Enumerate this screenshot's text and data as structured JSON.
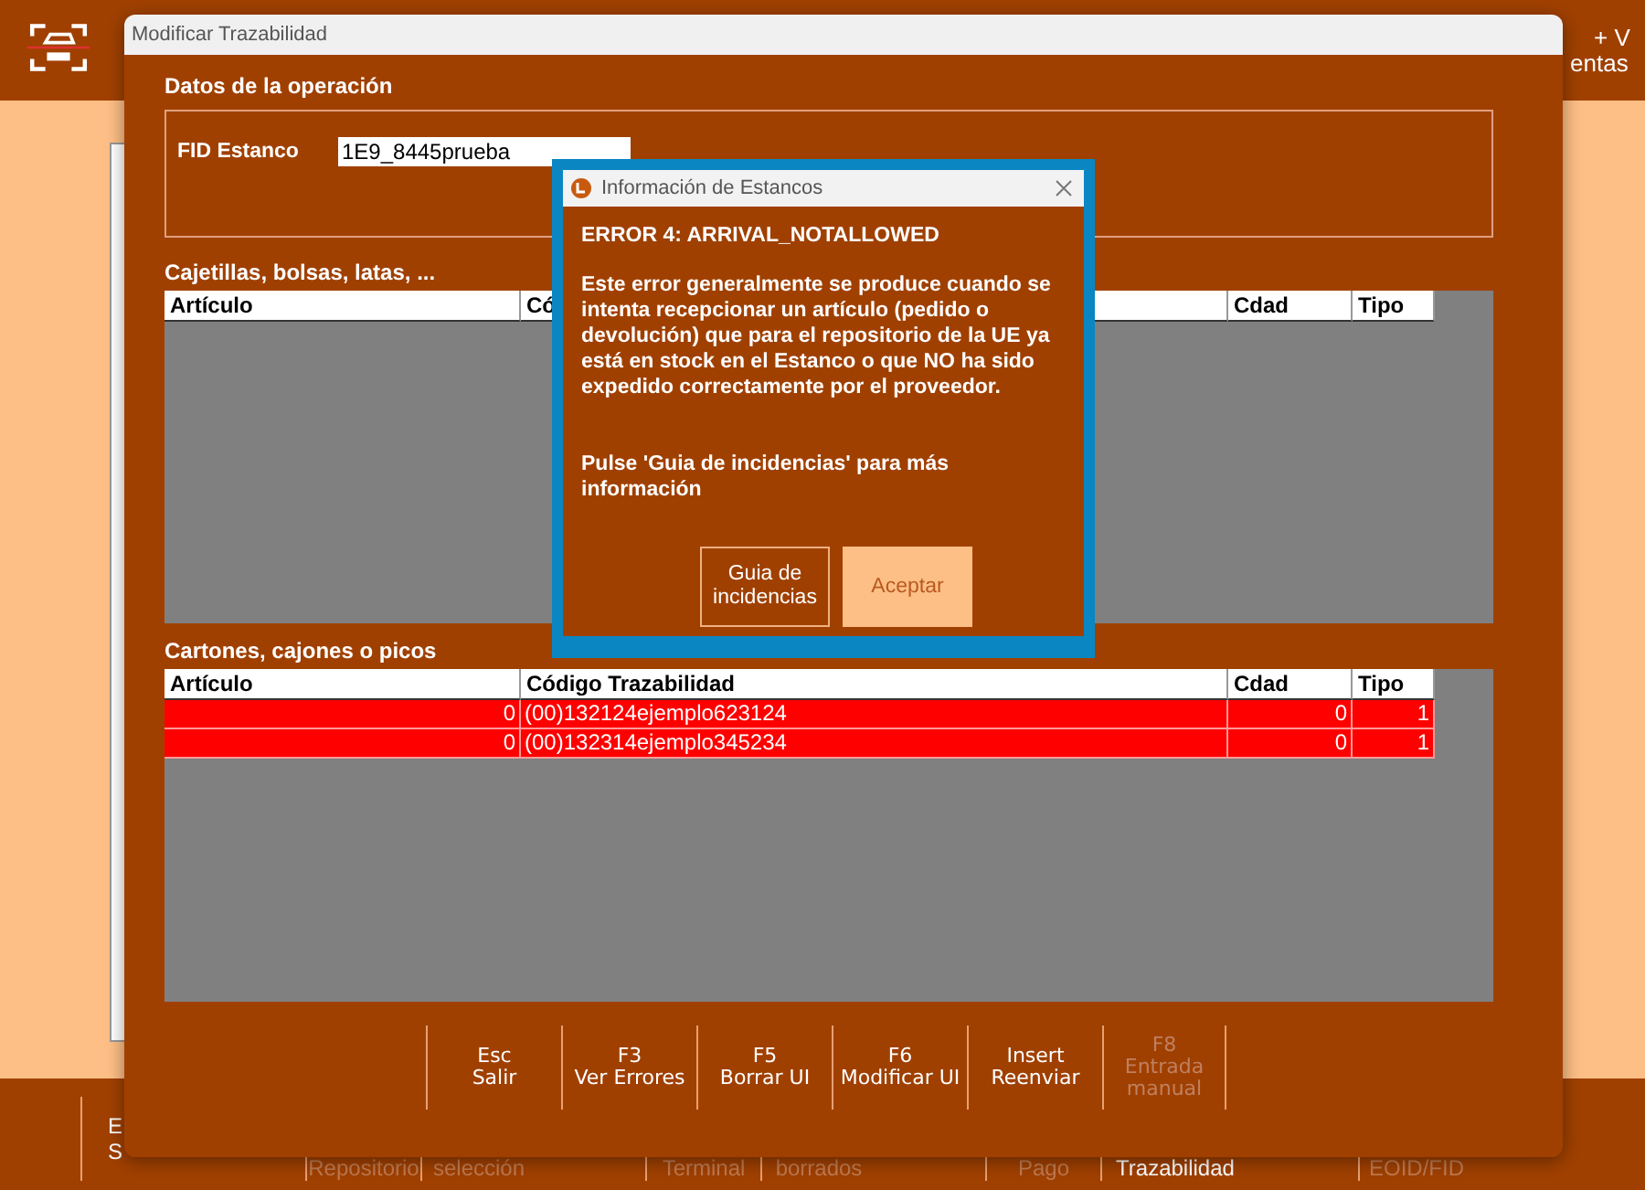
{
  "background_app": {
    "header_fragments": [
      "+ V",
      "entas"
    ],
    "footer_items": [
      {
        "lines": [
          "E",
          "S"
        ]
      },
      {
        "lines": [
          "Repositorio"
        ]
      },
      {
        "lines": [
          "selección"
        ]
      },
      {
        "lines": [
          "Terminal"
        ]
      },
      {
        "lines": [
          "borrados"
        ]
      },
      {
        "lines": [
          "Pago"
        ]
      },
      {
        "lines": [
          "Trazabilidad"
        ]
      },
      {
        "lines": [
          "EOID/FID"
        ]
      }
    ]
  },
  "window": {
    "title": "Modificar Trazabilidad",
    "operation": {
      "title": "Datos de la operación",
      "field_label": "FID Estanco",
      "field_value": "1E9_8445prueba"
    },
    "tables": [
      {
        "title": "Cajetillas, bolsas, latas, ...",
        "columns": [
          "Artículo",
          "Có",
          "Cdad",
          "Tipo"
        ]
      },
      {
        "title": "Cartones, cajones o picos",
        "columns": [
          "Artículo",
          "Código Trazabilidad",
          "Cdad",
          "Tipo"
        ],
        "rows": [
          {
            "error": true,
            "cells": [
              "0",
              "(00)132124ejemplo623124",
              "0",
              "1"
            ]
          },
          {
            "error": true,
            "cells": [
              "0",
              "(00)132314ejemplo345234",
              "0",
              "1"
            ]
          }
        ]
      }
    ],
    "function_keys": [
      {
        "key": "Esc",
        "label": "Salir",
        "disabled": false
      },
      {
        "key": "F3",
        "label": "Ver Errores",
        "disabled": false
      },
      {
        "key": "F5",
        "label": "Borrar UI",
        "disabled": false
      },
      {
        "key": "F6",
        "label": "Modificar UI",
        "disabled": false
      },
      {
        "key": "Insert",
        "label": "Reenviar",
        "disabled": false
      },
      {
        "key": "F8",
        "label": "Entrada manual",
        "disabled": true
      }
    ]
  },
  "dialog": {
    "title": "Información de Estancos",
    "heading": "ERROR 4: ARRIVAL_NOTALLOWED",
    "paragraphs": [
      "Este error generalmente se produce cuando se intenta recepcionar un artículo (pedido o devolución) que para el repositorio de la UE ya está en stock en el Estanco o que NO ha sido expedido correctamente por el proveedor.",
      "Pulse 'Guia de incidencias' para más información"
    ],
    "buttons": [
      {
        "label": "Guia de incidencias",
        "kind": "secondary"
      },
      {
        "label": "Aceptar",
        "kind": "primary"
      }
    ]
  }
}
